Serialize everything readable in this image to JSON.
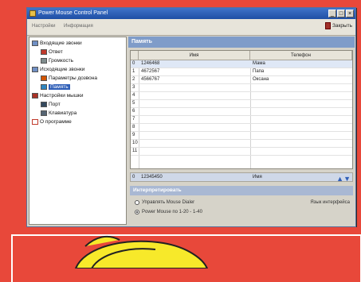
{
  "window": {
    "title": "Power Mouse Control Panel",
    "buttons": [
      "_",
      "□",
      "×"
    ]
  },
  "toolbar": {
    "item1": "Настройки",
    "item2": "Информация",
    "close_label": "Закрыть"
  },
  "tree": {
    "items": [
      {
        "label": "Входящие звонки",
        "level": 0,
        "icon": "folder-icon"
      },
      {
        "label": "Ответ",
        "level": 1,
        "icon": "phone-icon"
      },
      {
        "label": "Громкость",
        "level": 1,
        "icon": "speaker-icon"
      },
      {
        "label": "Исходящие звонки",
        "level": 0,
        "icon": "folder-icon"
      },
      {
        "label": "Параметры дозвона",
        "level": 1,
        "icon": "dial-icon"
      },
      {
        "label": "Память",
        "level": 1,
        "icon": "memory-icon",
        "selected": true
      },
      {
        "label": "Настройки мышки",
        "level": 0,
        "icon": "folder-icon"
      },
      {
        "label": "Порт",
        "level": 1,
        "icon": "port-icon"
      },
      {
        "label": "Клавиатура",
        "level": 1,
        "icon": "keyboard-icon"
      },
      {
        "label": "О программе",
        "level": 0,
        "icon": "check-icon"
      }
    ]
  },
  "panel": {
    "title": "Память",
    "columns": [
      "Имя",
      "Телефон"
    ],
    "rows": [
      {
        "num": "0",
        "name": "1246468",
        "phone": "Мама"
      },
      {
        "num": "1",
        "name": "4672567",
        "phone": "Папа"
      },
      {
        "num": "2",
        "name": "4566767",
        "phone": "Оксана"
      },
      {
        "num": "3",
        "name": "",
        "phone": ""
      },
      {
        "num": "4",
        "name": "",
        "phone": ""
      },
      {
        "num": "5",
        "name": "",
        "phone": ""
      },
      {
        "num": "6",
        "name": "",
        "phone": ""
      },
      {
        "num": "7",
        "name": "",
        "phone": ""
      },
      {
        "num": "8",
        "name": "",
        "phone": ""
      },
      {
        "num": "9",
        "name": "",
        "phone": ""
      },
      {
        "num": "10",
        "name": "",
        "phone": ""
      },
      {
        "num": "11",
        "name": "",
        "phone": ""
      }
    ],
    "status": {
      "num": "0",
      "value": "12345450",
      "name": "Имя"
    },
    "arrows": "▲▼",
    "group_label": "Интерпретировать",
    "radio1": "Управлять Mouse Dialer",
    "radio2": "Power Mouse по 1-20 - 1-40",
    "radio_selected": 2,
    "lang_link": "Язык интерфейса"
  },
  "colors": {
    "background": "#e8483a",
    "title_bar": "#2f5fb8",
    "panel_header": "#7f9cc9"
  }
}
